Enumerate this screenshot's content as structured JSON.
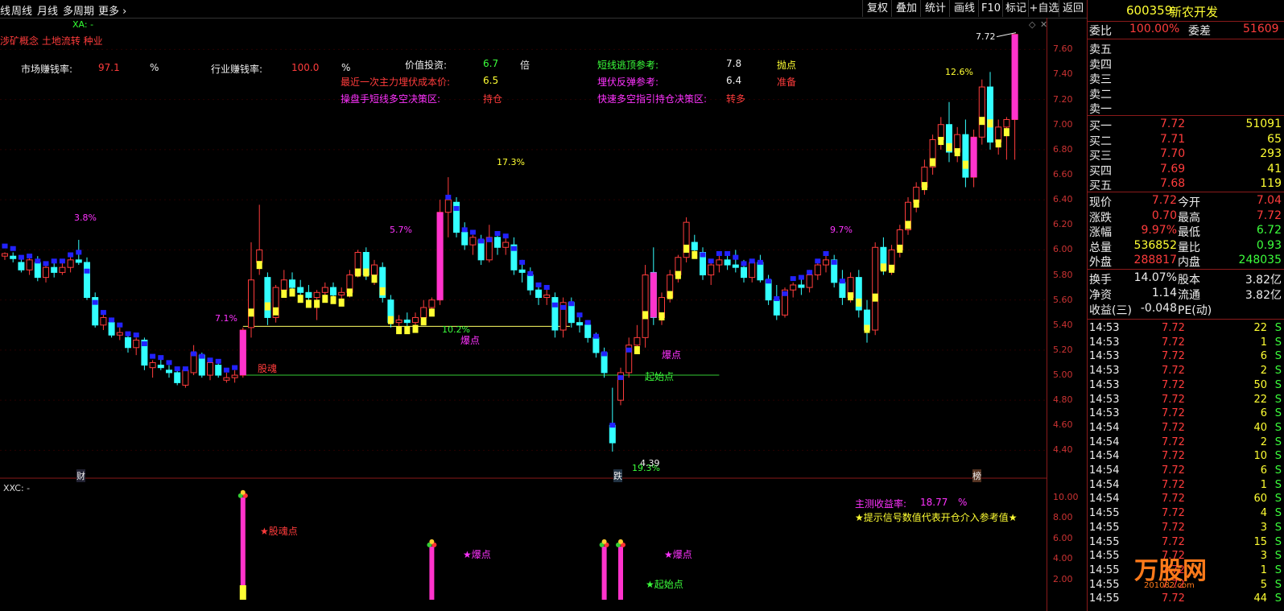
{
  "toolbar": {
    "left_items": [
      "线",
      "周线",
      "月线",
      "多周期",
      "更多"
    ],
    "right_items": [
      "复权",
      "叠加",
      "统计",
      "画线",
      "F10",
      "标记",
      "+自选",
      "返回"
    ]
  },
  "main_chart": {
    "indicator_title": "XA: -",
    "concept_text": "涉矿概念 土地流转 种业",
    "stats": {
      "market_win_label": "市场赚钱率:",
      "market_win_value": "97.1",
      "market_win_unit": "%",
      "industry_win_label": "行业赚钱率:",
      "industry_win_value": "100.0",
      "industry_win_unit": "%",
      "value_invest_label": "价值投资:",
      "value_invest_value": "6.7",
      "value_invest_unit": "倍",
      "cost_label": "最近一次主力埋伏成本价:",
      "cost_value": "6.5",
      "trader_label": "操盘手短线多空决策区:",
      "trader_value": "持仓",
      "short_top_label": "短线逃顶参考:",
      "short_top_value": "7.8",
      "short_top_signal": "抛点",
      "rebound_label": "埋伏反弹参考:",
      "rebound_value": "6.4",
      "rebound_signal": "准备",
      "quick_label": "快速多空指引持仓决策区:",
      "quick_value": "转多"
    },
    "y_ticks": [
      "7.60",
      "7.40",
      "7.20",
      "7.00",
      "6.80",
      "6.60",
      "6.40",
      "6.20",
      "6.00",
      "5.80",
      "5.60",
      "5.40",
      "5.20",
      "5.00",
      "4.80",
      "4.60",
      "4.40"
    ],
    "annotations": {
      "pct_1": "3.8%",
      "pct_2": "7.1%",
      "pct_3": "5.7%",
      "pct_4": "17.3%",
      "pct_5": "10.2%",
      "pct_6": "9.7%",
      "pct_7": "12.6%",
      "pct_8": "19.3%",
      "low_price": "4.39",
      "high_price": "7.72",
      "sig_guhun": "股魂",
      "sig_baodian1": "爆点",
      "sig_baodian2": "爆点",
      "sig_qishidian": "起始点",
      "tag_cai": "财",
      "tag_die": "跌",
      "tag_bang": "榜"
    }
  },
  "sub_chart": {
    "indicator_title": "XXC: -",
    "profit_label": "主测收益率:",
    "profit_value": "18.77",
    "profit_unit": "%",
    "hint": "★提示信号数值代表开仓介入参考值★",
    "y_ticks": [
      "10.00",
      "8.00",
      "6.00",
      "4.00",
      "2.00"
    ],
    "labels": {
      "s1": "★股魂点",
      "s2": "★爆点",
      "s3": "★爆点",
      "s4": "★起始点"
    }
  },
  "quote": {
    "code": "600359",
    "name": "新农开发",
    "ratio_label": "委比",
    "ratio_value": "100.00%",
    "diff_label": "委差",
    "diff_value": "51609",
    "sells": [
      {
        "label": "卖五",
        "price": "",
        "vol": ""
      },
      {
        "label": "卖四",
        "price": "",
        "vol": ""
      },
      {
        "label": "卖三",
        "price": "",
        "vol": ""
      },
      {
        "label": "卖二",
        "price": "",
        "vol": ""
      },
      {
        "label": "卖一",
        "price": "",
        "vol": ""
      }
    ],
    "buys": [
      {
        "label": "买一",
        "price": "7.72",
        "vol": "51091"
      },
      {
        "label": "买二",
        "price": "7.71",
        "vol": "65"
      },
      {
        "label": "买三",
        "price": "7.70",
        "vol": "293"
      },
      {
        "label": "买四",
        "price": "7.69",
        "vol": "41"
      },
      {
        "label": "买五",
        "price": "7.68",
        "vol": "119"
      }
    ],
    "stats": [
      {
        "l1": "现价",
        "v1": "7.72",
        "c1": "red",
        "l2": "今开",
        "v2": "7.04",
        "c2": "red"
      },
      {
        "l1": "涨跌",
        "v1": "0.70",
        "c1": "red",
        "l2": "最高",
        "v2": "7.72",
        "c2": "red"
      },
      {
        "l1": "涨幅",
        "v1": "9.97%",
        "c1": "red",
        "l2": "最低",
        "v2": "6.72",
        "c2": "green"
      },
      {
        "l1": "总量",
        "v1": "536852",
        "c1": "yellow",
        "l2": "量比",
        "v2": "0.93",
        "c2": "green"
      },
      {
        "l1": "外盘",
        "v1": "288817",
        "c1": "red",
        "l2": "内盘",
        "v2": "248035",
        "c2": "green"
      }
    ],
    "stats2": [
      {
        "l1": "换手",
        "v1": "14.07%",
        "l2": "股本",
        "v2": "3.82亿"
      },
      {
        "l1": "净资",
        "v1": "1.14",
        "l2": "流通",
        "v2": "3.82亿"
      },
      {
        "l1": "收益(三)",
        "v1": "-0.048",
        "l2": "PE(动)",
        "v2": ""
      }
    ],
    "ticks": [
      {
        "t": "14:53",
        "p": "7.72",
        "v": "22",
        "s": "S"
      },
      {
        "t": "14:53",
        "p": "7.72",
        "v": "1",
        "s": "S"
      },
      {
        "t": "14:53",
        "p": "7.72",
        "v": "6",
        "s": "S"
      },
      {
        "t": "14:53",
        "p": "7.72",
        "v": "2",
        "s": "S"
      },
      {
        "t": "14:53",
        "p": "7.72",
        "v": "50",
        "s": "S"
      },
      {
        "t": "14:53",
        "p": "7.72",
        "v": "22",
        "s": "S"
      },
      {
        "t": "14:53",
        "p": "7.72",
        "v": "6",
        "s": "S"
      },
      {
        "t": "14:54",
        "p": "7.72",
        "v": "40",
        "s": "S"
      },
      {
        "t": "14:54",
        "p": "7.72",
        "v": "2",
        "s": "S"
      },
      {
        "t": "14:54",
        "p": "7.72",
        "v": "10",
        "s": "S"
      },
      {
        "t": "14:54",
        "p": "7.72",
        "v": "6",
        "s": "S"
      },
      {
        "t": "14:54",
        "p": "7.72",
        "v": "1",
        "s": "S"
      },
      {
        "t": "14:54",
        "p": "7.72",
        "v": "60",
        "s": "S"
      },
      {
        "t": "14:55",
        "p": "7.72",
        "v": "4",
        "s": "S"
      },
      {
        "t": "14:55",
        "p": "7.72",
        "v": "3",
        "s": "S"
      },
      {
        "t": "14:55",
        "p": "7.72",
        "v": "15",
        "s": "S"
      },
      {
        "t": "14:55",
        "p": "7.72",
        "v": "3",
        "s": "S"
      },
      {
        "t": "14:55",
        "p": "7.72",
        "v": "1",
        "s": "S"
      },
      {
        "t": "14:55",
        "p": "7.72",
        "v": "5",
        "s": "S"
      },
      {
        "t": "14:55",
        "p": "7.72",
        "v": "44",
        "s": "S"
      }
    ],
    "watermark": "万股网",
    "watermark_url": "201082.com"
  },
  "chart_data": {
    "type": "candlestick",
    "candles": [
      [
        5.95,
        5.98,
        5.92,
        5.97
      ],
      [
        5.95,
        5.98,
        5.9,
        5.93
      ],
      [
        5.9,
        5.93,
        5.82,
        5.84
      ],
      [
        5.84,
        5.95,
        5.8,
        5.92
      ],
      [
        5.9,
        5.95,
        5.75,
        5.78
      ],
      [
        5.78,
        5.9,
        5.74,
        5.86
      ],
      [
        5.86,
        5.92,
        5.78,
        5.82
      ],
      [
        5.82,
        5.9,
        5.8,
        5.86
      ],
      [
        5.86,
        5.96,
        5.82,
        5.92
      ],
      [
        5.92,
        6.08,
        5.88,
        5.9
      ],
      [
        5.9,
        5.94,
        5.6,
        5.62
      ],
      [
        5.62,
        5.66,
        5.38,
        5.4
      ],
      [
        5.4,
        5.5,
        5.36,
        5.46
      ],
      [
        5.42,
        5.46,
        5.3,
        5.32
      ],
      [
        5.32,
        5.38,
        5.28,
        5.34
      ],
      [
        5.3,
        5.34,
        5.18,
        5.22
      ],
      [
        5.22,
        5.3,
        5.16,
        5.28
      ],
      [
        5.28,
        5.3,
        5.04,
        5.08
      ],
      [
        5.06,
        5.12,
        4.98,
        5.1
      ],
      [
        5.08,
        5.14,
        5.04,
        5.06
      ],
      [
        5.04,
        5.08,
        4.98,
        5.02
      ],
      [
        5.02,
        5.06,
        4.92,
        4.94
      ],
      [
        4.92,
        5.06,
        4.9,
        5.04
      ],
      [
        5.02,
        5.24,
        5.0,
        5.18
      ],
      [
        5.16,
        5.18,
        4.98,
        5.0
      ],
      [
        5.0,
        5.12,
        4.96,
        5.1
      ],
      [
        5.08,
        5.1,
        4.98,
        5.0
      ],
      [
        4.96,
        5.02,
        4.94,
        4.98
      ],
      [
        4.98,
        5.04,
        4.94,
        5.0
      ],
      [
        5.0,
        5.38,
        4.98,
        5.36
      ],
      [
        5.38,
        6.06,
        5.3,
        5.76
      ],
      [
        5.9,
        6.36,
        5.8,
        6.0
      ],
      [
        5.78,
        5.82,
        5.4,
        5.46
      ],
      [
        5.46,
        5.72,
        5.42,
        5.7
      ],
      [
        5.68,
        5.84,
        5.66,
        5.76
      ],
      [
        5.76,
        5.82,
        5.64,
        5.7
      ],
      [
        5.7,
        5.76,
        5.62,
        5.66
      ],
      [
        5.66,
        5.72,
        5.56,
        5.62
      ],
      [
        5.62,
        5.68,
        5.44,
        5.66
      ],
      [
        5.66,
        5.74,
        5.6,
        5.7
      ],
      [
        5.7,
        5.74,
        5.62,
        5.64
      ],
      [
        5.64,
        5.7,
        5.58,
        5.66
      ],
      [
        5.66,
        5.84,
        5.62,
        5.8
      ],
      [
        5.8,
        6.0,
        5.78,
        5.98
      ],
      [
        5.98,
        6.02,
        5.76,
        5.8
      ],
      [
        5.8,
        5.92,
        5.72,
        5.88
      ],
      [
        5.86,
        5.9,
        5.58,
        5.62
      ],
      [
        5.6,
        5.64,
        5.38,
        5.42
      ],
      [
        5.42,
        5.48,
        5.36,
        5.44
      ],
      [
        5.44,
        5.5,
        5.38,
        5.42
      ],
      [
        5.42,
        5.5,
        5.4,
        5.46
      ],
      [
        5.46,
        5.6,
        5.42,
        5.54
      ],
      [
        5.54,
        5.62,
        5.48,
        5.6
      ],
      [
        5.6,
        6.4,
        5.56,
        6.3
      ],
      [
        6.3,
        6.58,
        6.1,
        6.4
      ],
      [
        6.38,
        6.42,
        6.1,
        6.14
      ],
      [
        6.14,
        6.22,
        6.0,
        6.04
      ],
      [
        6.04,
        6.12,
        5.96,
        6.1
      ],
      [
        6.08,
        6.12,
        5.88,
        5.92
      ],
      [
        5.92,
        6.2,
        5.9,
        6.1
      ],
      [
        6.1,
        6.14,
        5.96,
        6.02
      ],
      [
        6.02,
        6.1,
        5.96,
        6.06
      ],
      [
        6.04,
        6.1,
        5.8,
        5.84
      ],
      [
        5.84,
        5.92,
        5.74,
        5.82
      ],
      [
        5.8,
        5.86,
        5.64,
        5.68
      ],
      [
        5.68,
        5.72,
        5.56,
        5.62
      ],
      [
        5.62,
        5.7,
        5.56,
        5.64
      ],
      [
        5.62,
        5.66,
        5.3,
        5.36
      ],
      [
        5.36,
        5.62,
        5.3,
        5.58
      ],
      [
        5.58,
        5.62,
        5.38,
        5.42
      ],
      [
        5.42,
        5.48,
        5.34,
        5.4
      ],
      [
        5.4,
        5.44,
        5.26,
        5.3
      ],
      [
        5.3,
        5.34,
        5.14,
        5.18
      ],
      [
        5.18,
        5.22,
        4.98,
        5.02
      ],
      [
        4.6,
        4.9,
        4.39,
        4.46
      ],
      [
        4.8,
        5.06,
        4.76,
        5.02
      ],
      [
        5.02,
        5.3,
        4.98,
        5.24
      ],
      [
        5.24,
        5.4,
        5.2,
        5.3
      ],
      [
        5.3,
        5.88,
        5.22,
        5.8
      ],
      [
        5.82,
        6.02,
        5.4,
        5.46
      ],
      [
        5.46,
        5.66,
        5.4,
        5.62
      ],
      [
        5.62,
        5.84,
        5.58,
        5.8
      ],
      [
        5.8,
        5.96,
        5.74,
        5.94
      ],
      [
        5.94,
        6.26,
        5.9,
        6.22
      ],
      [
        6.06,
        6.12,
        5.94,
        6.0
      ],
      [
        5.98,
        6.02,
        5.76,
        5.8
      ],
      [
        5.8,
        5.9,
        5.72,
        5.88
      ],
      [
        5.88,
        5.98,
        5.82,
        5.92
      ],
      [
        5.92,
        5.96,
        5.84,
        5.88
      ],
      [
        5.88,
        6.0,
        5.82,
        5.86
      ],
      [
        5.86,
        5.92,
        5.74,
        5.78
      ],
      [
        5.78,
        5.92,
        5.74,
        5.9
      ],
      [
        5.9,
        5.96,
        5.74,
        5.76
      ],
      [
        5.76,
        5.8,
        5.56,
        5.6
      ],
      [
        5.6,
        5.72,
        5.44,
        5.48
      ],
      [
        5.48,
        5.7,
        5.46,
        5.68
      ],
      [
        5.68,
        5.74,
        5.62,
        5.72
      ],
      [
        5.72,
        5.78,
        5.64,
        5.7
      ],
      [
        5.7,
        5.84,
        5.66,
        5.8
      ],
      [
        5.8,
        5.92,
        5.76,
        5.88
      ],
      [
        5.88,
        5.98,
        5.82,
        5.92
      ],
      [
        5.92,
        5.96,
        5.7,
        5.74
      ],
      [
        5.74,
        5.84,
        5.56,
        5.62
      ],
      [
        5.62,
        5.82,
        5.58,
        5.78
      ],
      [
        5.78,
        5.84,
        5.46,
        5.52
      ],
      [
        5.52,
        5.6,
        5.26,
        5.36
      ],
      [
        5.36,
        6.06,
        5.32,
        6.02
      ],
      [
        6.02,
        6.1,
        5.8,
        5.84
      ],
      [
        5.84,
        6.04,
        5.8,
        6.0
      ],
      [
        6.0,
        6.2,
        5.94,
        6.16
      ],
      [
        6.16,
        6.42,
        6.12,
        6.38
      ],
      [
        6.38,
        6.54,
        6.3,
        6.5
      ],
      [
        6.5,
        6.72,
        6.44,
        6.66
      ],
      [
        6.66,
        6.92,
        6.6,
        6.88
      ],
      [
        6.88,
        7.06,
        6.8,
        7.0
      ],
      [
        7.0,
        7.18,
        6.7,
        6.78
      ],
      [
        6.78,
        6.98,
        6.7,
        6.92
      ],
      [
        6.92,
        7.04,
        6.5,
        6.58
      ],
      [
        6.58,
        6.96,
        6.5,
        6.9
      ],
      [
        6.9,
        7.36,
        6.84,
        7.3
      ],
      [
        7.3,
        7.42,
        6.8,
        6.86
      ],
      [
        6.86,
        7.04,
        6.76,
        6.98
      ],
      [
        6.98,
        7.06,
        6.72,
        7.04
      ],
      [
        7.04,
        7.72,
        6.72,
        7.72
      ]
    ],
    "marks": [
      {
        "type": "pct",
        "idx": 9,
        "value": "3.8%"
      },
      {
        "type": "pct",
        "idx": 23,
        "value": "7.1%"
      },
      {
        "type": "pct",
        "idx": 43,
        "value": "5.7%"
      },
      {
        "type": "pct",
        "idx": 54,
        "value": "17.3%"
      },
      {
        "type": "pct",
        "idx": 90,
        "value": "9.7%"
      },
      {
        "type": "pct",
        "idx": 114,
        "value": "12.6%"
      }
    ],
    "ylim": [
      4.3,
      7.75
    ],
    "supports": [
      {
        "y": 5.39,
        "from": 29,
        "to": 60,
        "color": "#ffff66"
      },
      {
        "y": 5.0,
        "from": 29,
        "to": 87,
        "color": "#33cc33"
      }
    ],
    "sub_signals": [
      {
        "idx": 29,
        "value": 10.0
      },
      {
        "idx": 52,
        "value": 5.2
      },
      {
        "idx": 73,
        "value": 5.2
      },
      {
        "idx": 75,
        "value": 5.2
      }
    ],
    "sub_ylim": [
      0,
      11
    ]
  }
}
